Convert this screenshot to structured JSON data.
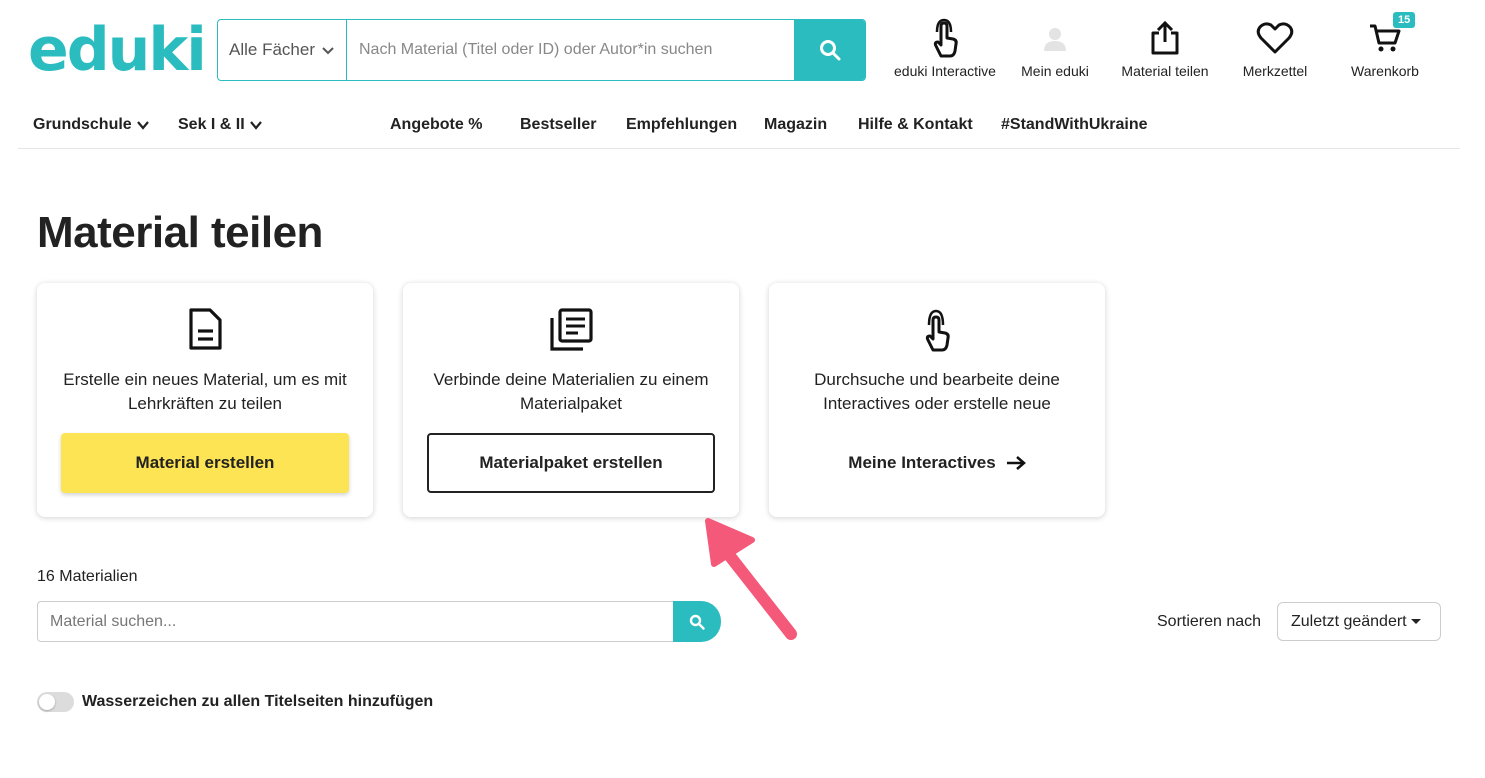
{
  "logo": {
    "text": "eduki"
  },
  "search": {
    "category": "Alle Fächer",
    "placeholder": "Nach Material (Titel oder ID) oder Autor*in suchen"
  },
  "header_icons": [
    {
      "label": "eduki Interactive",
      "icon": "hand-pointer-icon"
    },
    {
      "label": "Mein eduki",
      "icon": "user-icon"
    },
    {
      "label": "Material teilen",
      "icon": "share-upload-icon"
    },
    {
      "label": "Merkzettel",
      "icon": "heart-icon"
    },
    {
      "label": "Warenkorb",
      "icon": "cart-icon",
      "badge": "15"
    }
  ],
  "nav": {
    "grundschule": "Grundschule",
    "sek": "Sek I & II",
    "angebote": "Angebote %",
    "bestseller": "Bestseller",
    "empfehlungen": "Empfehlungen",
    "magazin": "Magazin",
    "hilfe": "Hilfe & Kontakt",
    "ukraine": "#StandWithUkraine"
  },
  "page_title": "Material teilen",
  "cards": [
    {
      "icon": "document-icon",
      "text": "Erstelle ein neues Material, um es mit Lehrkräften zu teilen",
      "button": "Material erstellen"
    },
    {
      "icon": "collection-icon",
      "text": "Verbinde deine Materialien zu einem Materialpaket",
      "button": "Materialpaket erstellen"
    },
    {
      "icon": "hand-pointer-icon",
      "text": "Durchsuche und bearbeite deine Interactives oder erstelle neue",
      "button": "Meine Interactives"
    }
  ],
  "materials": {
    "count": "16 Materialien",
    "search_placeholder": "Material suchen...",
    "sort_label": "Sortieren nach",
    "sort_value": "Zuletzt geändert"
  },
  "watermark": {
    "label": "Wasserzeichen zu allen Titelseiten hinzufügen",
    "enabled": false
  },
  "colors": {
    "brand": "#2bbcbf",
    "primary_button": "#fde454",
    "annotation_arrow": "#f5597a"
  }
}
